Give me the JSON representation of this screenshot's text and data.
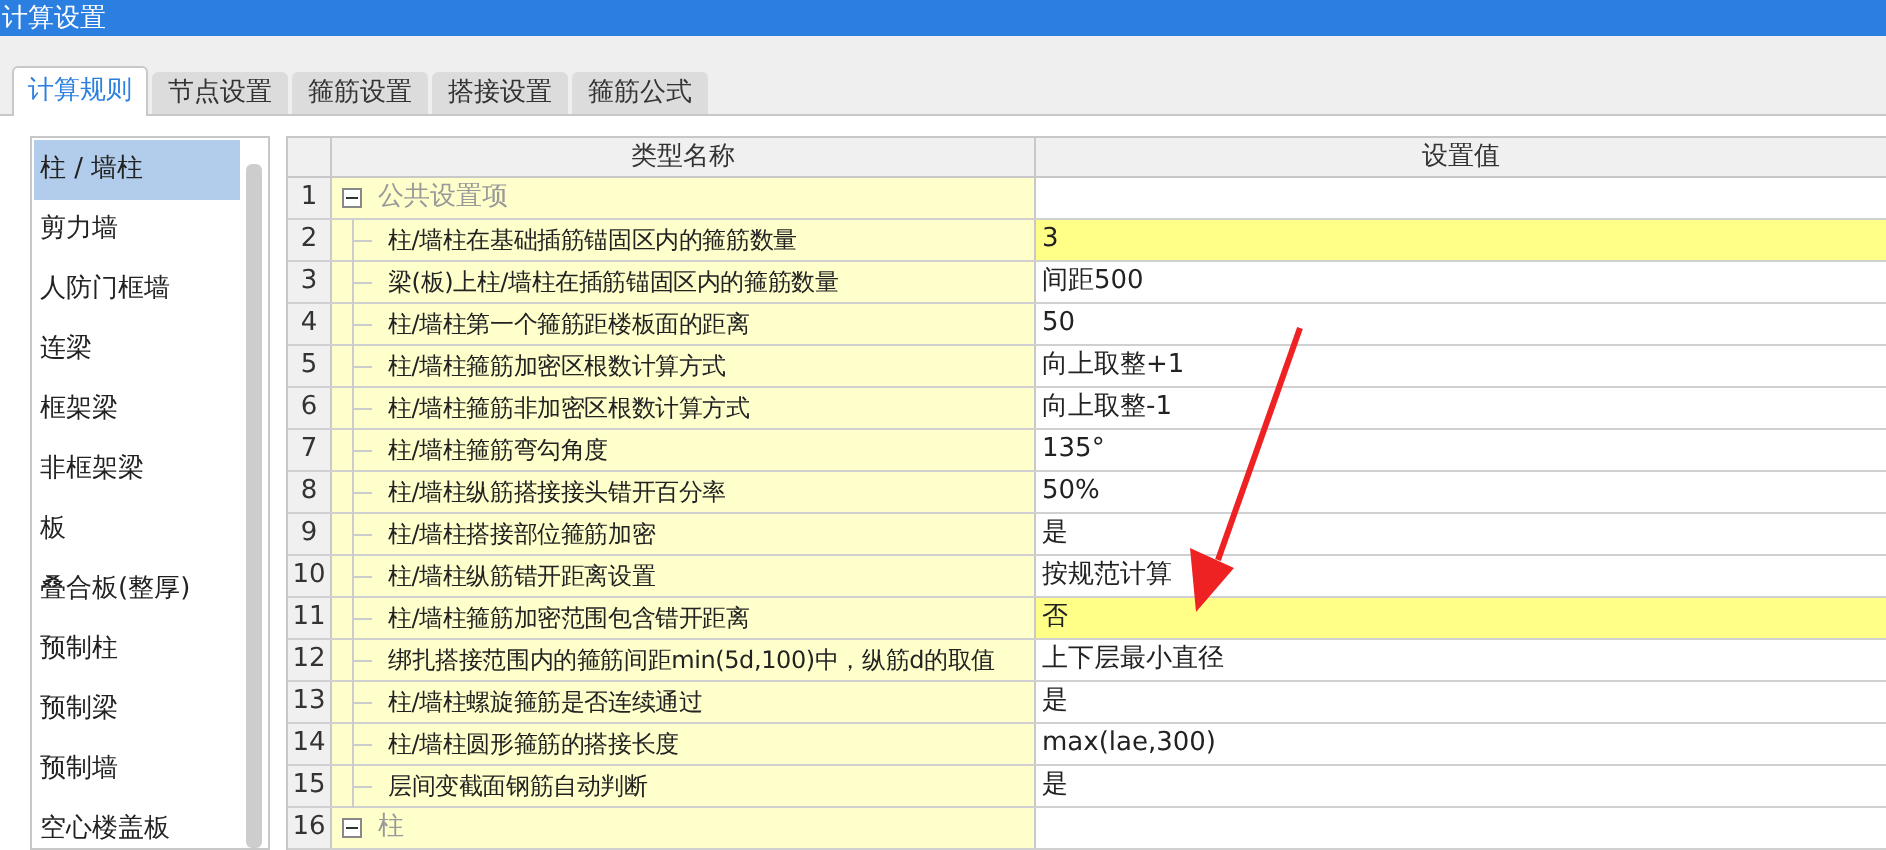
{
  "window": {
    "title": "计算设置"
  },
  "tabs": [
    {
      "label": "计算规则",
      "selected": true
    },
    {
      "label": "节点设置",
      "selected": false
    },
    {
      "label": "箍筋设置",
      "selected": false
    },
    {
      "label": "搭接设置",
      "selected": false
    },
    {
      "label": "箍筋公式",
      "selected": false
    }
  ],
  "sidebar": {
    "items": [
      {
        "label": "柱 / 墙柱",
        "selected": true
      },
      {
        "label": "剪力墙",
        "selected": false
      },
      {
        "label": "人防门框墙",
        "selected": false
      },
      {
        "label": "连梁",
        "selected": false
      },
      {
        "label": "框架梁",
        "selected": false
      },
      {
        "label": "非框架梁",
        "selected": false
      },
      {
        "label": "板",
        "selected": false
      },
      {
        "label": "叠合板(整厚)",
        "selected": false
      },
      {
        "label": "预制柱",
        "selected": false
      },
      {
        "label": "预制梁",
        "selected": false
      },
      {
        "label": "预制墙",
        "selected": false
      },
      {
        "label": "空心楼盖板",
        "selected": false
      }
    ]
  },
  "table": {
    "columns": [
      "类型名称",
      "设置值"
    ],
    "rows": [
      {
        "number": "1",
        "kind": "group",
        "expanded": true,
        "name": "公共设置项"
      },
      {
        "number": "2",
        "kind": "item",
        "name": "柱/墙柱在基础插筋锚固区内的箍筋数量",
        "value": "3",
        "highlighted": true
      },
      {
        "number": "3",
        "kind": "item",
        "name": "梁(板)上柱/墙柱在插筋锚固区内的箍筋数量",
        "value": "间距500",
        "highlighted": false
      },
      {
        "number": "4",
        "kind": "item",
        "name": "柱/墙柱第一个箍筋距楼板面的距离",
        "value": "50",
        "highlighted": false
      },
      {
        "number": "5",
        "kind": "item",
        "name": "柱/墙柱箍筋加密区根数计算方式",
        "value": "向上取整+1",
        "highlighted": false
      },
      {
        "number": "6",
        "kind": "item",
        "name": "柱/墙柱箍筋非加密区根数计算方式",
        "value": "向上取整-1",
        "highlighted": false
      },
      {
        "number": "7",
        "kind": "item",
        "name": "柱/墙柱箍筋弯勾角度",
        "value": "135°",
        "highlighted": false
      },
      {
        "number": "8",
        "kind": "item",
        "name": "柱/墙柱纵筋搭接接头错开百分率",
        "value": "50%",
        "highlighted": false
      },
      {
        "number": "9",
        "kind": "item",
        "name": "柱/墙柱搭接部位箍筋加密",
        "value": "是",
        "highlighted": false
      },
      {
        "number": "10",
        "kind": "item",
        "name": "柱/墙柱纵筋错开距离设置",
        "value": "按规范计算",
        "highlighted": false
      },
      {
        "number": "11",
        "kind": "item",
        "name": "柱/墙柱箍筋加密范围包含错开距离",
        "value": "否",
        "highlighted": true
      },
      {
        "number": "12",
        "kind": "item",
        "name": "绑扎搭接范围内的箍筋间距min(5d,100)中，纵筋d的取值",
        "value": "上下层最小直径",
        "highlighted": false
      },
      {
        "number": "13",
        "kind": "item",
        "name": "柱/墙柱螺旋箍筋是否连续通过",
        "value": "是",
        "highlighted": false
      },
      {
        "number": "14",
        "kind": "item",
        "name": "柱/墙柱圆形箍筋的搭接长度",
        "value": "max(lae,300)",
        "highlighted": false
      },
      {
        "number": "15",
        "kind": "item",
        "name": "层间变截面钢筋自动判断",
        "value": "是",
        "highlighted": false
      },
      {
        "number": "16",
        "kind": "group",
        "expanded": true,
        "name": "柱"
      }
    ]
  }
}
